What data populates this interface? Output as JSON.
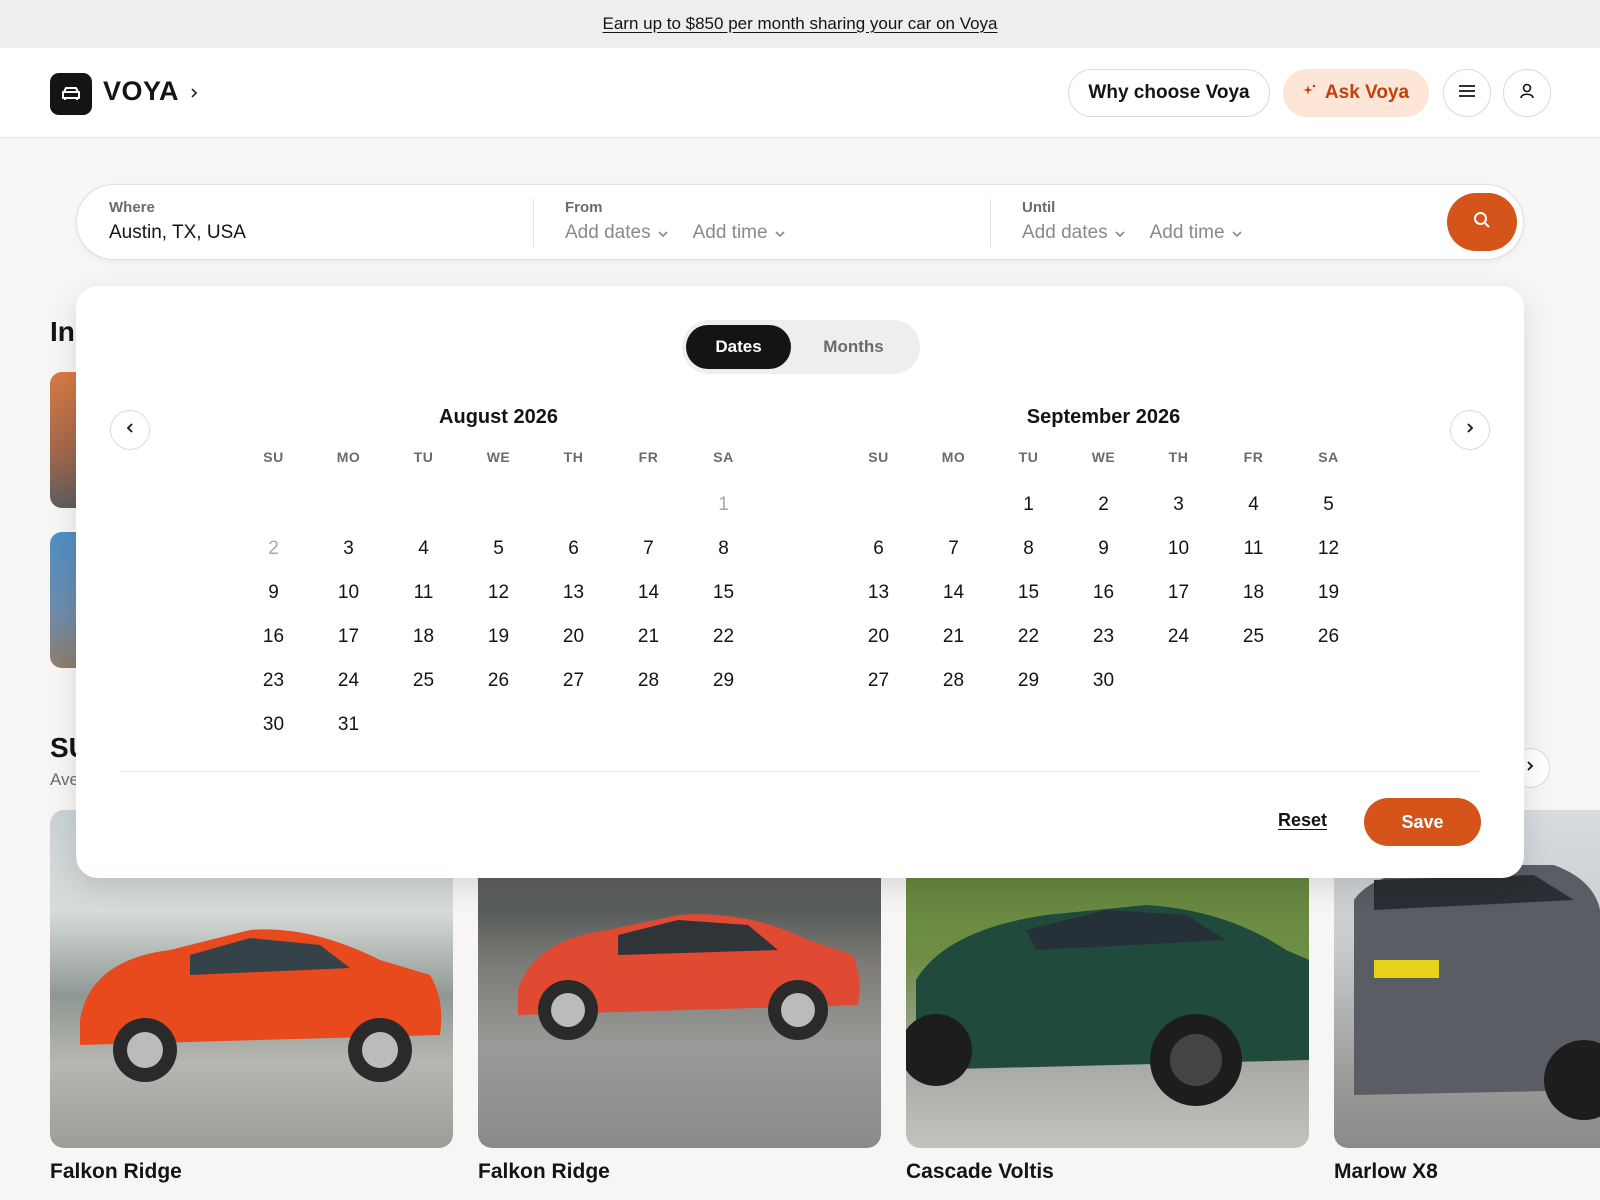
{
  "promo": {
    "text": "Earn up to $850 per month sharing your car on Voya"
  },
  "header": {
    "brand": "VOYA",
    "why_label": "Why choose Voya",
    "ask_label": "Ask Voya",
    "icons": [
      "car-icon",
      "chevron-right-icon",
      "sparkle-icon",
      "menu-icon",
      "user-icon"
    ]
  },
  "search": {
    "where_label": "Where",
    "where_value": "Austin, TX, USA",
    "from_label": "From",
    "from_dates": "Add dates",
    "from_time": "Add time",
    "until_label": "Until",
    "until_dates": "Add dates",
    "until_time": "Add time"
  },
  "background": {
    "section1_title_partial": "In",
    "section2_title_partial": "SU",
    "section2_sub_partial": "Ave"
  },
  "picker": {
    "tabs": {
      "dates": "Dates",
      "months": "Months"
    },
    "weekdays": [
      "SU",
      "MO",
      "TU",
      "WE",
      "TH",
      "FR",
      "SA"
    ],
    "months": [
      {
        "title": "August 2026",
        "days": [
          "",
          "",
          "",
          "",
          "",
          "",
          "1",
          "2",
          "3",
          "4",
          "5",
          "6",
          "7",
          "8",
          "9",
          "10",
          "11",
          "12",
          "13",
          "14",
          "15",
          "16",
          "17",
          "18",
          "19",
          "20",
          "21",
          "22",
          "23",
          "24",
          "25",
          "26",
          "27",
          "28",
          "29",
          "30",
          "31"
        ],
        "muted_days": [
          "1",
          "2"
        ]
      },
      {
        "title": "September 2026",
        "days": [
          "",
          "",
          "1",
          "2",
          "3",
          "4",
          "5",
          "6",
          "7",
          "8",
          "9",
          "10",
          "11",
          "12",
          "13",
          "14",
          "15",
          "16",
          "17",
          "18",
          "19",
          "20",
          "21",
          "22",
          "23",
          "24",
          "25",
          "26",
          "27",
          "28",
          "29",
          "30"
        ],
        "muted_days": []
      }
    ],
    "reset_label": "Reset",
    "save_label": "Save"
  },
  "cars": [
    {
      "name": "Falkon Ridge",
      "color": "#e8491d"
    },
    {
      "name": "Falkon Ridge",
      "color": "#e04a32"
    },
    {
      "name": "Cascade Voltis",
      "color": "#1f4a3c"
    },
    {
      "name": "Marlow X8",
      "color": "#5a5d63"
    }
  ],
  "colors": {
    "accent": "#d4541a",
    "accent_soft": "#fde5d7",
    "dark": "#141414"
  }
}
